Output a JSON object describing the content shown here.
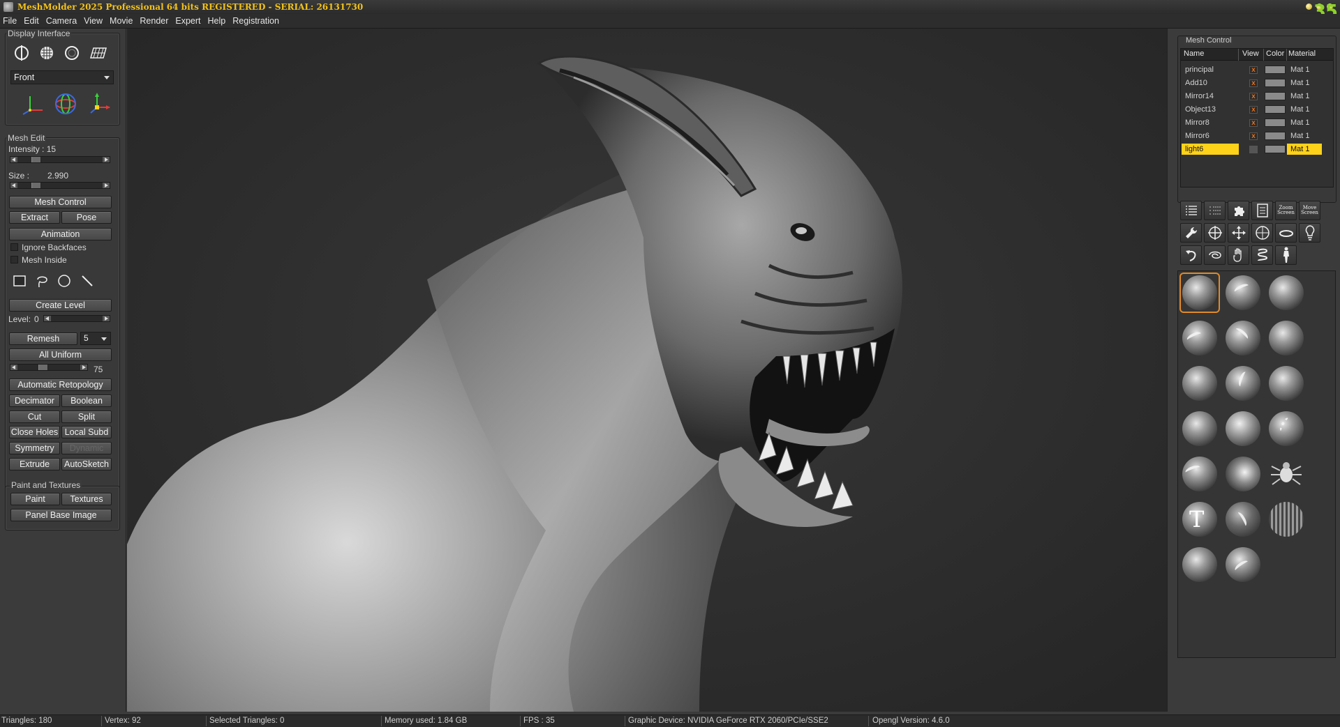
{
  "window": {
    "title": "MeshMolder 2025 Professional 64 bits REGISTERED - SERIAL: 26131730",
    "fps_display": "35"
  },
  "menu": [
    "File",
    "Edit",
    "Camera",
    "View",
    "Movie",
    "Render",
    "Expert",
    "Help",
    "Registration"
  ],
  "display_interface": {
    "title": "Display Interface",
    "view_select": "Front",
    "display_modes": [
      "solid-shaded-icon",
      "textured-sphere-icon",
      "wire-sphere-icon",
      "plane-grid-icon"
    ],
    "gizmos": [
      "axis-gizmo-icon",
      "rotate-gizmo-icon",
      "move-gizmo-icon"
    ]
  },
  "mesh_edit": {
    "title": "Mesh Edit",
    "intensity_label": "Intensity : 15",
    "intensity_value": 15,
    "size_label": "Size :",
    "size_value": "2.990",
    "mesh_control": "Mesh Control",
    "extract": "Extract",
    "pose": "Pose",
    "animation": "Animation",
    "ignore_backfaces": "Ignore Backfaces",
    "mesh_inside": "Mesh Inside",
    "select_tools": [
      "rectangle-select-icon",
      "lasso-select-icon",
      "circle-select-icon",
      "line-select-icon"
    ],
    "create_level": "Create Level",
    "level_label": "Level:",
    "level_value": "0",
    "remesh": "Remesh",
    "remesh_value": "5",
    "all_uniform": "All Uniform",
    "uniform_value": "75",
    "automatic_retopology": "Automatic Retopology",
    "decimator": "Decimator",
    "boolean": "Boolean",
    "cut": "Cut",
    "split": "Split",
    "close_holes": "Close Holes",
    "local_subd": "Local Subd",
    "symmetry": "Symmetry",
    "dynamic": "Dynamic",
    "extrude": "Extrude",
    "autosketch": "AutoSketch"
  },
  "paint_textures": {
    "title": "Paint and Textures",
    "paint": "Paint",
    "textures": "Textures",
    "panel_base_image": "Panel Base Image"
  },
  "mesh_control": {
    "title": "Mesh Control",
    "columns": [
      "Name",
      "View",
      "Color",
      "Material"
    ],
    "rows": [
      {
        "name": "principal",
        "view": "x",
        "material": "Mat 1",
        "selected": false
      },
      {
        "name": "Add10",
        "view": "x",
        "material": "Mat 1",
        "selected": false
      },
      {
        "name": "Mirror14",
        "view": "x",
        "material": "Mat 1",
        "selected": false
      },
      {
        "name": "Object13",
        "view": "x",
        "material": "Mat 1",
        "selected": false
      },
      {
        "name": "Mirror8",
        "view": "x",
        "material": "Mat 1",
        "selected": false
      },
      {
        "name": "Mirror6",
        "view": "x",
        "material": "Mat 1",
        "selected": false
      },
      {
        "name": "light6",
        "view": "",
        "material": "Mat 1",
        "selected": true
      }
    ],
    "selected_color": "#ffd21a"
  },
  "toolbar": {
    "zoom_screen": "Zoom Screen",
    "move_screen": "Move Screen",
    "icons": [
      "list-icon",
      "list-dotted-icon",
      "puzzle-icon",
      "document-icon",
      "zoom-screen",
      "move-screen",
      "wrench-icon",
      "target-icon",
      "move-arrows-icon",
      "crosshair-circle-icon",
      "ring-icon",
      "lightbulb-icon",
      "undo-curve-icon",
      "twist-icon",
      "hand-icon",
      "spring-icon",
      "figure-icon"
    ]
  },
  "brushes": [
    "standard-brush",
    "crease-brush",
    "smooth-brush",
    "clay-brush",
    "wrinkle-brush",
    "inflate-brush",
    "flatten-brush",
    "hook-brush",
    "pinch-brush",
    "polish-brush",
    "noise-brush",
    "chain-brush",
    "snake-hook-brush",
    "blob-brush",
    "stamp-brush",
    "text-brush",
    "planar-brush",
    "mesh-brush",
    "layer-brush",
    "scratch-brush"
  ],
  "status": {
    "triangles": "Triangles: 180",
    "vertex": "Vertex: 92",
    "selected_triangles": "Selected Triangles: 0",
    "memory": "Memory used: 1.84 GB",
    "fps": "FPS : 35",
    "graphic_device": "Graphic Device: NVIDIA GeForce RTX 2060/PCIe/SSE2",
    "opengl": "Opengl Version: 4.6.0"
  },
  "colors": {
    "accent": "#f2c21a",
    "fps": "#8cd22a",
    "selected_brush_border": "#e08a2a"
  }
}
